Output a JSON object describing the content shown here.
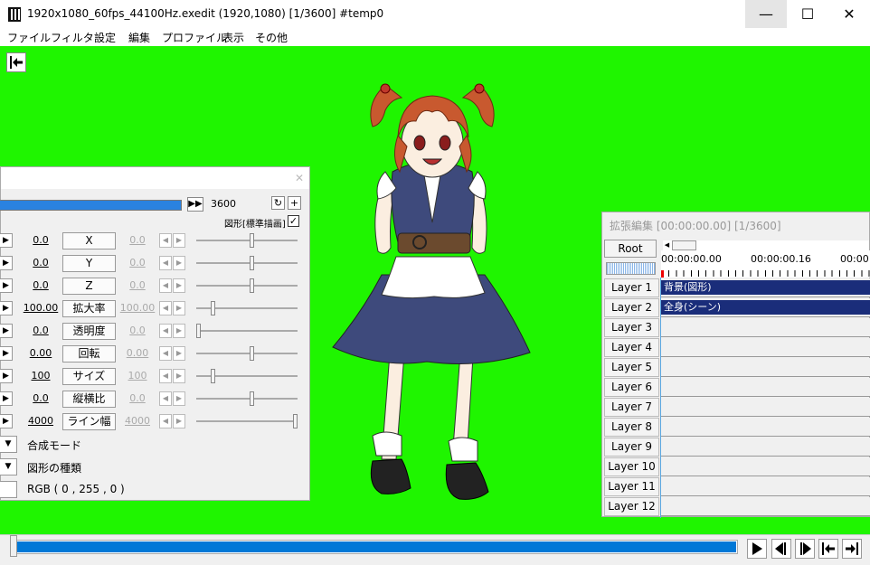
{
  "window": {
    "title": "1920x1080_60fps_44100Hz.exedit (1920,1080)  [1/3600]  #temp0",
    "minimize": "—",
    "maximize": "☐",
    "close": "✕"
  },
  "menu": [
    "ファイル",
    "フィルタ",
    "設定",
    "編集",
    "プロファイル",
    "表示",
    "その他"
  ],
  "canvas": {
    "background_color": "#1ff500",
    "back_icon": "⇤"
  },
  "properties": {
    "frame_end": "3600",
    "shape_option_label": "図形[標準描画]",
    "shape_option_checked": "✓",
    "rows": [
      {
        "label": "X",
        "left_value": "0.0",
        "right_value": "0.0",
        "level": 0.55
      },
      {
        "label": "Y",
        "left_value": "0.0",
        "right_value": "0.0",
        "level": 0.55
      },
      {
        "label": "Z",
        "left_value": "0.0",
        "right_value": "0.0",
        "level": 0.55
      },
      {
        "label": "拡大率",
        "left_value": "100.00",
        "right_value": "100.00",
        "level": 0.15
      },
      {
        "label": "透明度",
        "left_value": "0.0",
        "right_value": "0.0",
        "level": 0.0
      },
      {
        "label": "回転",
        "left_value": "0.00",
        "right_value": "0.00",
        "level": 0.55
      },
      {
        "label": "サイズ",
        "left_value": "100",
        "right_value": "100",
        "level": 0.15
      },
      {
        "label": "縦横比",
        "left_value": "0.0",
        "right_value": "0.0",
        "level": 0.55
      },
      {
        "label": "ライン幅",
        "left_value": "4000",
        "right_value": "4000",
        "level": 1.0
      }
    ],
    "blend_mode_label": "合成モード",
    "shape_type_label": "図形の種類",
    "color_label": "RGB ( 0 , 255 , 0 )"
  },
  "timeline": {
    "title": "拡張編集 [00:00:00.00] [1/3600]",
    "root_label": "Root",
    "timecodes": [
      "00:00:00.00",
      "00:00:00.16",
      "00:00:00"
    ],
    "layers": [
      "Layer 1",
      "Layer 2",
      "Layer 3",
      "Layer 4",
      "Layer 5",
      "Layer 6",
      "Layer 7",
      "Layer 8",
      "Layer 9",
      "Layer 10",
      "Layer 11",
      "Layer 12"
    ],
    "clips": [
      {
        "layer": 1,
        "label": "背景(図形)"
      },
      {
        "layer": 2,
        "label": "全身(シーン)"
      }
    ]
  },
  "playback": {
    "position_fraction": 1.0,
    "buttons": [
      "play-icon",
      "prev-frame-icon",
      "next-frame-icon",
      "go-start-icon",
      "go-end-icon"
    ]
  }
}
